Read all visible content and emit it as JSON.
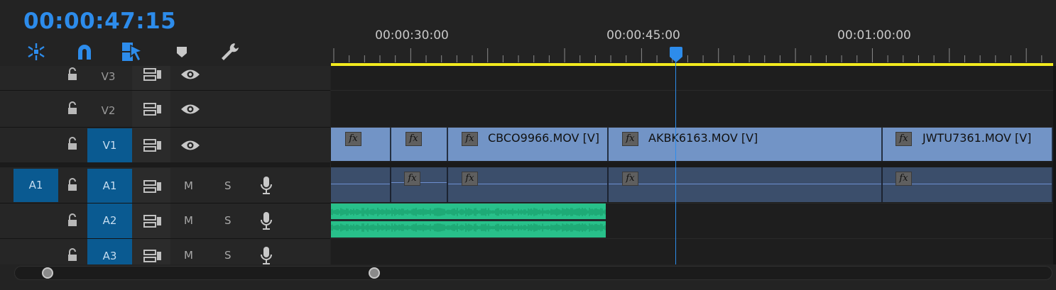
{
  "timecode": "00:00:47:15",
  "toolbar": {
    "tools": [
      "snap-in-timeline-icon",
      "magnet-icon",
      "linked-selection-icon",
      "add-marker-icon",
      "wrench-icon"
    ]
  },
  "ruler": {
    "labels": [
      "00:00:30:00",
      "00:00:45:00",
      "00:01:00:00"
    ]
  },
  "tracks": {
    "video": [
      {
        "name": "V3",
        "targeted": false
      },
      {
        "name": "V2",
        "targeted": false
      },
      {
        "name": "V1",
        "targeted": true
      }
    ],
    "audio": [
      {
        "name": "A1",
        "source_patch": "A1",
        "mute": "M",
        "solo": "S"
      },
      {
        "name": "A2",
        "mute": "M",
        "solo": "S"
      },
      {
        "name": "A3",
        "mute": "M",
        "solo": "S"
      }
    ]
  },
  "clips": {
    "fx_label": "fx",
    "video": [
      {
        "name": ""
      },
      {
        "name": ""
      },
      {
        "name": "CBCO9966.MOV [V]"
      },
      {
        "name": "AKBK6163.MOV [V]"
      },
      {
        "name": "JWTU7361.MOV [V]"
      }
    ]
  },
  "colors": {
    "accent": "#2d8ceb",
    "track_target": "#0a5a91",
    "video_clip": "#7294c6",
    "audio_clip": "#3b4e6b",
    "audio_waveform": "#28c08a",
    "work_area": "#f2ea1e"
  }
}
